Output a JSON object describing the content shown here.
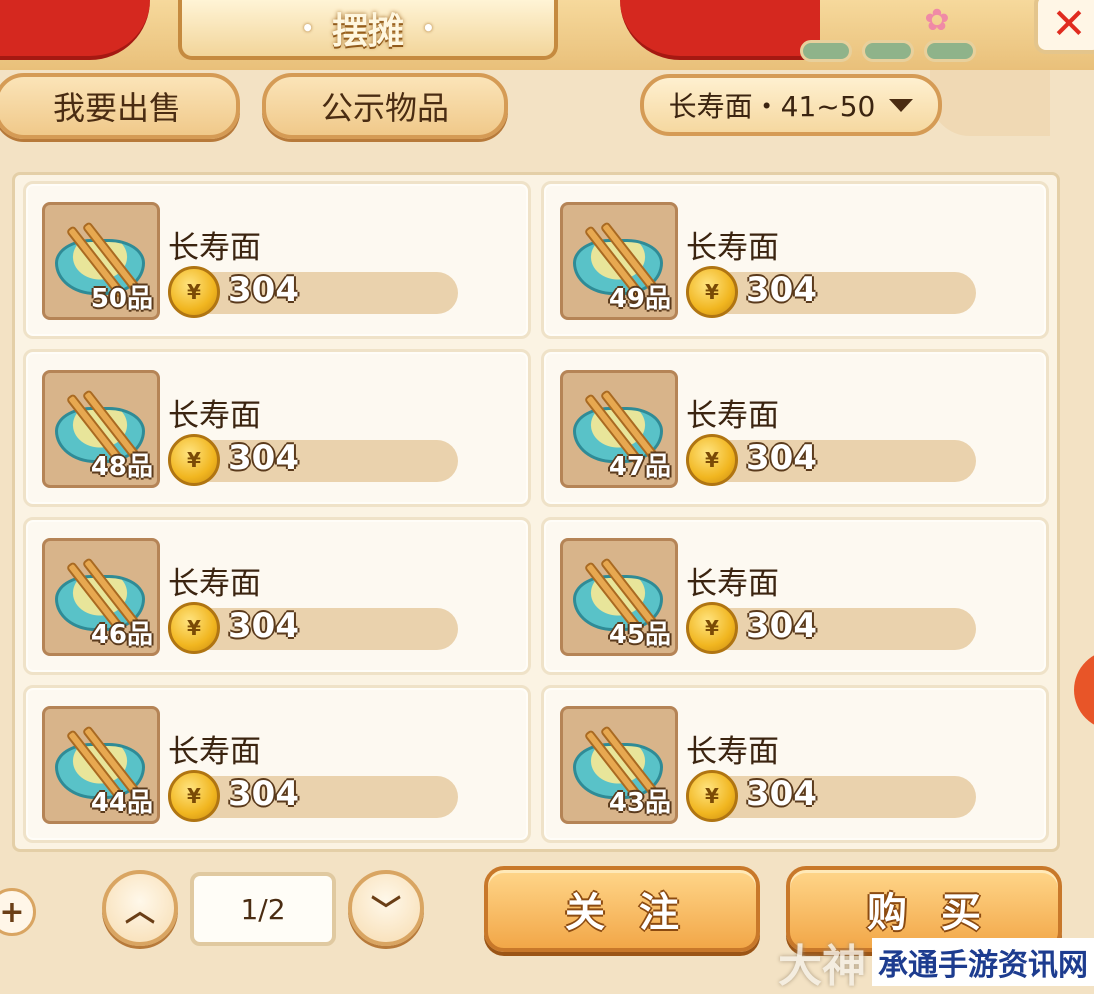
{
  "header": {
    "title": "摆摊",
    "close_glyph": "✕"
  },
  "tabs": [
    {
      "label": "我要出售"
    },
    {
      "label": "公示物品"
    }
  ],
  "filter": {
    "label": "长寿面・41~50"
  },
  "items": [
    {
      "name": "长寿面",
      "grade": "50品",
      "price": "304"
    },
    {
      "name": "长寿面",
      "grade": "49品",
      "price": "304"
    },
    {
      "name": "长寿面",
      "grade": "48品",
      "price": "304"
    },
    {
      "name": "长寿面",
      "grade": "47品",
      "price": "304"
    },
    {
      "name": "长寿面",
      "grade": "46品",
      "price": "304"
    },
    {
      "name": "长寿面",
      "grade": "45品",
      "price": "304"
    },
    {
      "name": "长寿面",
      "grade": "44品",
      "price": "304"
    },
    {
      "name": "长寿面",
      "grade": "43品",
      "price": "304"
    }
  ],
  "pagination": {
    "page": "1/2",
    "up_glyph": "︿",
    "down_glyph": "﹀",
    "plus_glyph": "+"
  },
  "actions": {
    "follow_label": "关注",
    "buy_label": "购买"
  },
  "watermark": {
    "logo": "大神",
    "site": "承通手游资讯网"
  },
  "icons": {
    "coin": "currency-coin-icon",
    "item": "longevity-noodle-bowl-icon"
  }
}
